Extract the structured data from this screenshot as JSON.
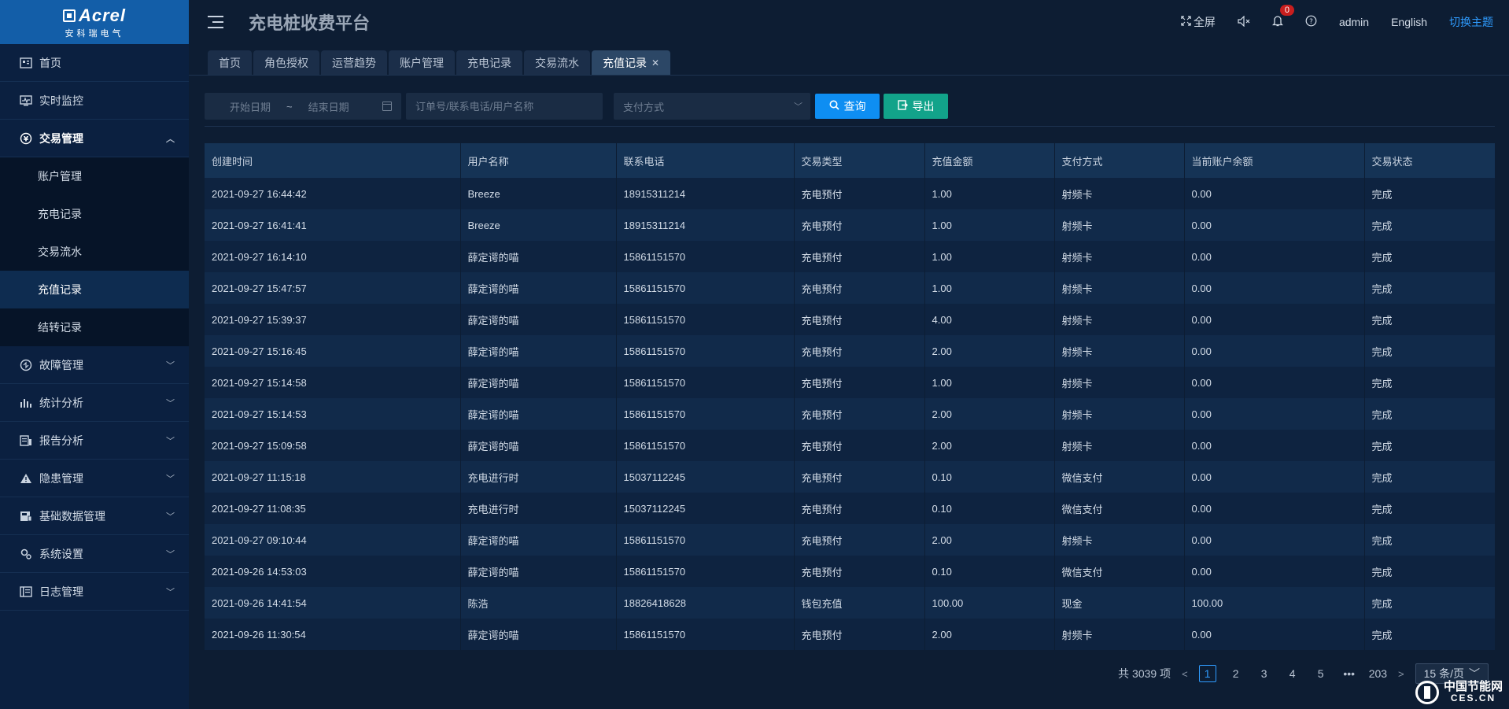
{
  "logo": {
    "brand": "Acrel",
    "brand_cn": "安科瑞电气"
  },
  "header": {
    "title": "充电桩收费平台",
    "fullscreen": "全屏",
    "notification_count": "0",
    "user": "admin",
    "language": "English",
    "theme_switch": "切换主题"
  },
  "sidebar": {
    "items": [
      {
        "label": "首页",
        "icon": "home-icon"
      },
      {
        "label": "实时监控",
        "icon": "monitor-icon"
      },
      {
        "label": "交易管理",
        "icon": "coin-icon"
      },
      {
        "label": "故障管理",
        "icon": "fault-icon"
      },
      {
        "label": "统计分析",
        "icon": "chart-icon"
      },
      {
        "label": "报告分析",
        "icon": "report-icon"
      },
      {
        "label": "隐患管理",
        "icon": "warning-icon"
      },
      {
        "label": "基础数据管理",
        "icon": "database-icon"
      },
      {
        "label": "系统设置",
        "icon": "gear-icon"
      },
      {
        "label": "日志管理",
        "icon": "log-icon"
      }
    ],
    "sub_items": [
      "账户管理",
      "充电记录",
      "交易流水",
      "充值记录",
      "结转记录"
    ]
  },
  "tabs": [
    "首页",
    "角色授权",
    "运营趋势",
    "账户管理",
    "充电记录",
    "交易流水",
    "充值记录"
  ],
  "filters": {
    "start_date_placeholder": "开始日期",
    "range_separator": "~",
    "end_date_placeholder": "结束日期",
    "search_placeholder": "订单号/联系电话/用户名称",
    "payment_placeholder": "支付方式",
    "query_label": "查询",
    "export_label": "导出"
  },
  "table": {
    "columns": [
      "创建时间",
      "用户名称",
      "联系电话",
      "交易类型",
      "充值金额",
      "支付方式",
      "当前账户余额",
      "交易状态"
    ],
    "rows": [
      [
        "2021-09-27 16:44:42",
        "Breeze",
        "18915311214",
        "充电预付",
        "1.00",
        "射频卡",
        "0.00",
        "完成"
      ],
      [
        "2021-09-27 16:41:41",
        "Breeze",
        "18915311214",
        "充电预付",
        "1.00",
        "射频卡",
        "0.00",
        "完成"
      ],
      [
        "2021-09-27 16:14:10",
        "薛定谔的喵",
        "15861151570",
        "充电预付",
        "1.00",
        "射频卡",
        "0.00",
        "完成"
      ],
      [
        "2021-09-27 15:47:57",
        "薛定谔的喵",
        "15861151570",
        "充电预付",
        "1.00",
        "射频卡",
        "0.00",
        "完成"
      ],
      [
        "2021-09-27 15:39:37",
        "薛定谔的喵",
        "15861151570",
        "充电预付",
        "4.00",
        "射频卡",
        "0.00",
        "完成"
      ],
      [
        "2021-09-27 15:16:45",
        "薛定谔的喵",
        "15861151570",
        "充电预付",
        "2.00",
        "射频卡",
        "0.00",
        "完成"
      ],
      [
        "2021-09-27 15:14:58",
        "薛定谔的喵",
        "15861151570",
        "充电预付",
        "1.00",
        "射频卡",
        "0.00",
        "完成"
      ],
      [
        "2021-09-27 15:14:53",
        "薛定谔的喵",
        "15861151570",
        "充电预付",
        "2.00",
        "射频卡",
        "0.00",
        "完成"
      ],
      [
        "2021-09-27 15:09:58",
        "薛定谔的喵",
        "15861151570",
        "充电预付",
        "2.00",
        "射频卡",
        "0.00",
        "完成"
      ],
      [
        "2021-09-27 11:15:18",
        "充电进行时",
        "15037112245",
        "充电预付",
        "0.10",
        "微信支付",
        "0.00",
        "完成"
      ],
      [
        "2021-09-27 11:08:35",
        "充电进行时",
        "15037112245",
        "充电预付",
        "0.10",
        "微信支付",
        "0.00",
        "完成"
      ],
      [
        "2021-09-27 09:10:44",
        "薛定谔的喵",
        "15861151570",
        "充电预付",
        "2.00",
        "射频卡",
        "0.00",
        "完成"
      ],
      [
        "2021-09-26 14:53:03",
        "薛定谔的喵",
        "15861151570",
        "充电预付",
        "0.10",
        "微信支付",
        "0.00",
        "完成"
      ],
      [
        "2021-09-26 14:41:54",
        "陈浩",
        "18826418628",
        "钱包充值",
        "100.00",
        "现金",
        "100.00",
        "完成"
      ],
      [
        "2021-09-26 11:30:54",
        "薛定谔的喵",
        "15861151570",
        "充电预付",
        "2.00",
        "射频卡",
        "0.00",
        "完成"
      ]
    ]
  },
  "pagination": {
    "total": "共 3039 项",
    "pages": [
      "1",
      "2",
      "3",
      "4",
      "5"
    ],
    "ellipsis": "•••",
    "last_page": "203",
    "page_size": "15 条/页"
  },
  "watermark": {
    "line1": "中国节能网",
    "line2": "CES.CN"
  }
}
